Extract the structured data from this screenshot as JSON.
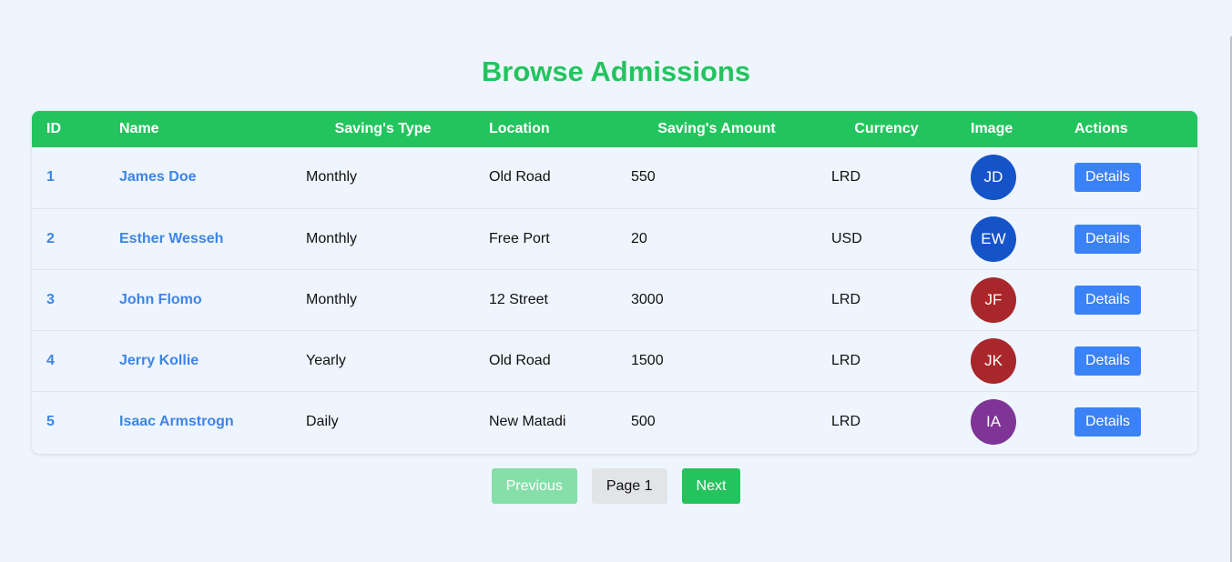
{
  "title": "Browse Admissions",
  "columns": [
    "ID",
    "Name",
    "Saving's Type",
    "Location",
    "Saving's Amount",
    "Currency",
    "Image",
    "Actions"
  ],
  "rows": [
    {
      "id": "1",
      "name": "James Doe",
      "type": "Monthly",
      "location": "Old Road",
      "amount": "550",
      "currency": "LRD",
      "initials": "JD",
      "avatar_color": "#1554c8",
      "action": "Details"
    },
    {
      "id": "2",
      "name": "Esther Wesseh",
      "type": "Monthly",
      "location": "Free Port",
      "amount": "20",
      "currency": "USD",
      "initials": "EW",
      "avatar_color": "#1554c8",
      "action": "Details"
    },
    {
      "id": "3",
      "name": "John Flomo",
      "type": "Monthly",
      "location": "12 Street",
      "amount": "3000",
      "currency": "LRD",
      "initials": "JF",
      "avatar_color": "#a8272a",
      "action": "Details"
    },
    {
      "id": "4",
      "name": "Jerry Kollie",
      "type": "Yearly",
      "location": "Old Road",
      "amount": "1500",
      "currency": "LRD",
      "initials": "JK",
      "avatar_color": "#a8272a",
      "action": "Details"
    },
    {
      "id": "5",
      "name": "Isaac Armstrogn",
      "type": "Daily",
      "location": "New Matadi",
      "amount": "500",
      "currency": "LRD",
      "initials": "IA",
      "avatar_color": "#7e3595",
      "action": "Details"
    }
  ],
  "pagination": {
    "previous": "Previous",
    "page": "Page 1",
    "next": "Next"
  },
  "colors": {
    "accent": "#23c45e",
    "link": "#3e84e6",
    "button": "#3b82f6"
  }
}
